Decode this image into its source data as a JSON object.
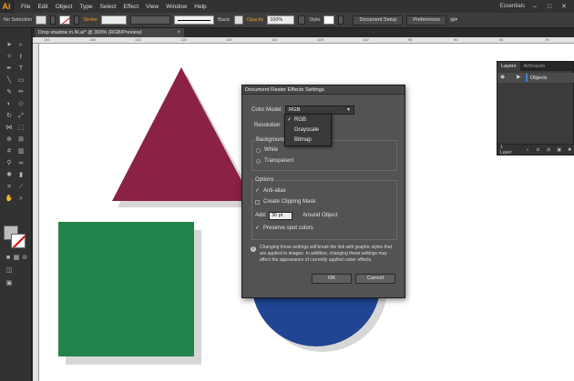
{
  "app": {
    "logo": "Ai"
  },
  "menu": [
    "File",
    "Edit",
    "Object",
    "Type",
    "Select",
    "Effect",
    "View",
    "Window",
    "Help"
  ],
  "menubar_right": {
    "workspace": "Essentials",
    "minimize": "–",
    "maximize": "□",
    "close": "✕"
  },
  "control": {
    "selection": "No Selection",
    "stroke_label": "Stroke",
    "brush": "Basic",
    "opacity_label": "Opacity",
    "opacity_value": "100%",
    "style_label": "Style",
    "doc_setup": "Document Setup",
    "preferences": "Preferences"
  },
  "document": {
    "tab_title": "Drop shadow in AI.ai* @ 300% (RGB/Preview)",
    "close": "×",
    "ruler_ticks": [
      "144",
      "138",
      "132",
      "126",
      "120",
      "114",
      "108",
      "102",
      "96",
      "90",
      "84",
      "78"
    ]
  },
  "colors": {
    "triangle": "#8b2147",
    "square": "#21844a",
    "circle": "#1f4593",
    "shadow": "#bdbdbd",
    "layer_color": "#4c80d6"
  },
  "layers_panel": {
    "tabs": [
      "Layers",
      "Artboards"
    ],
    "layer_name": "Objects",
    "count": "1 Layer"
  },
  "dialog": {
    "title": "Document Raster Effects Settings",
    "color_model_label": "Color Model:",
    "color_model_value": "RGB",
    "color_model_options": [
      "RGB",
      "Grayscale",
      "Bitmap"
    ],
    "resolution_label": "Resolution:",
    "background_label": "Background",
    "bg_white": "White",
    "bg_transparent": "Transparent",
    "options_label": "Options",
    "anti_alias": "Anti-alias",
    "clipping_mask": "Create Clipping Mask",
    "add_label": "Add:",
    "add_value": "36 pt",
    "around_object": "Around Object",
    "preserve_spot": "Preserve spot colors",
    "info": "Changing these settings will break the link with graphic styles that are applied to images. In addition, changing these settings may affect the appearance of currently applied raster effects.",
    "ok": "OK",
    "cancel": "Cancel"
  }
}
